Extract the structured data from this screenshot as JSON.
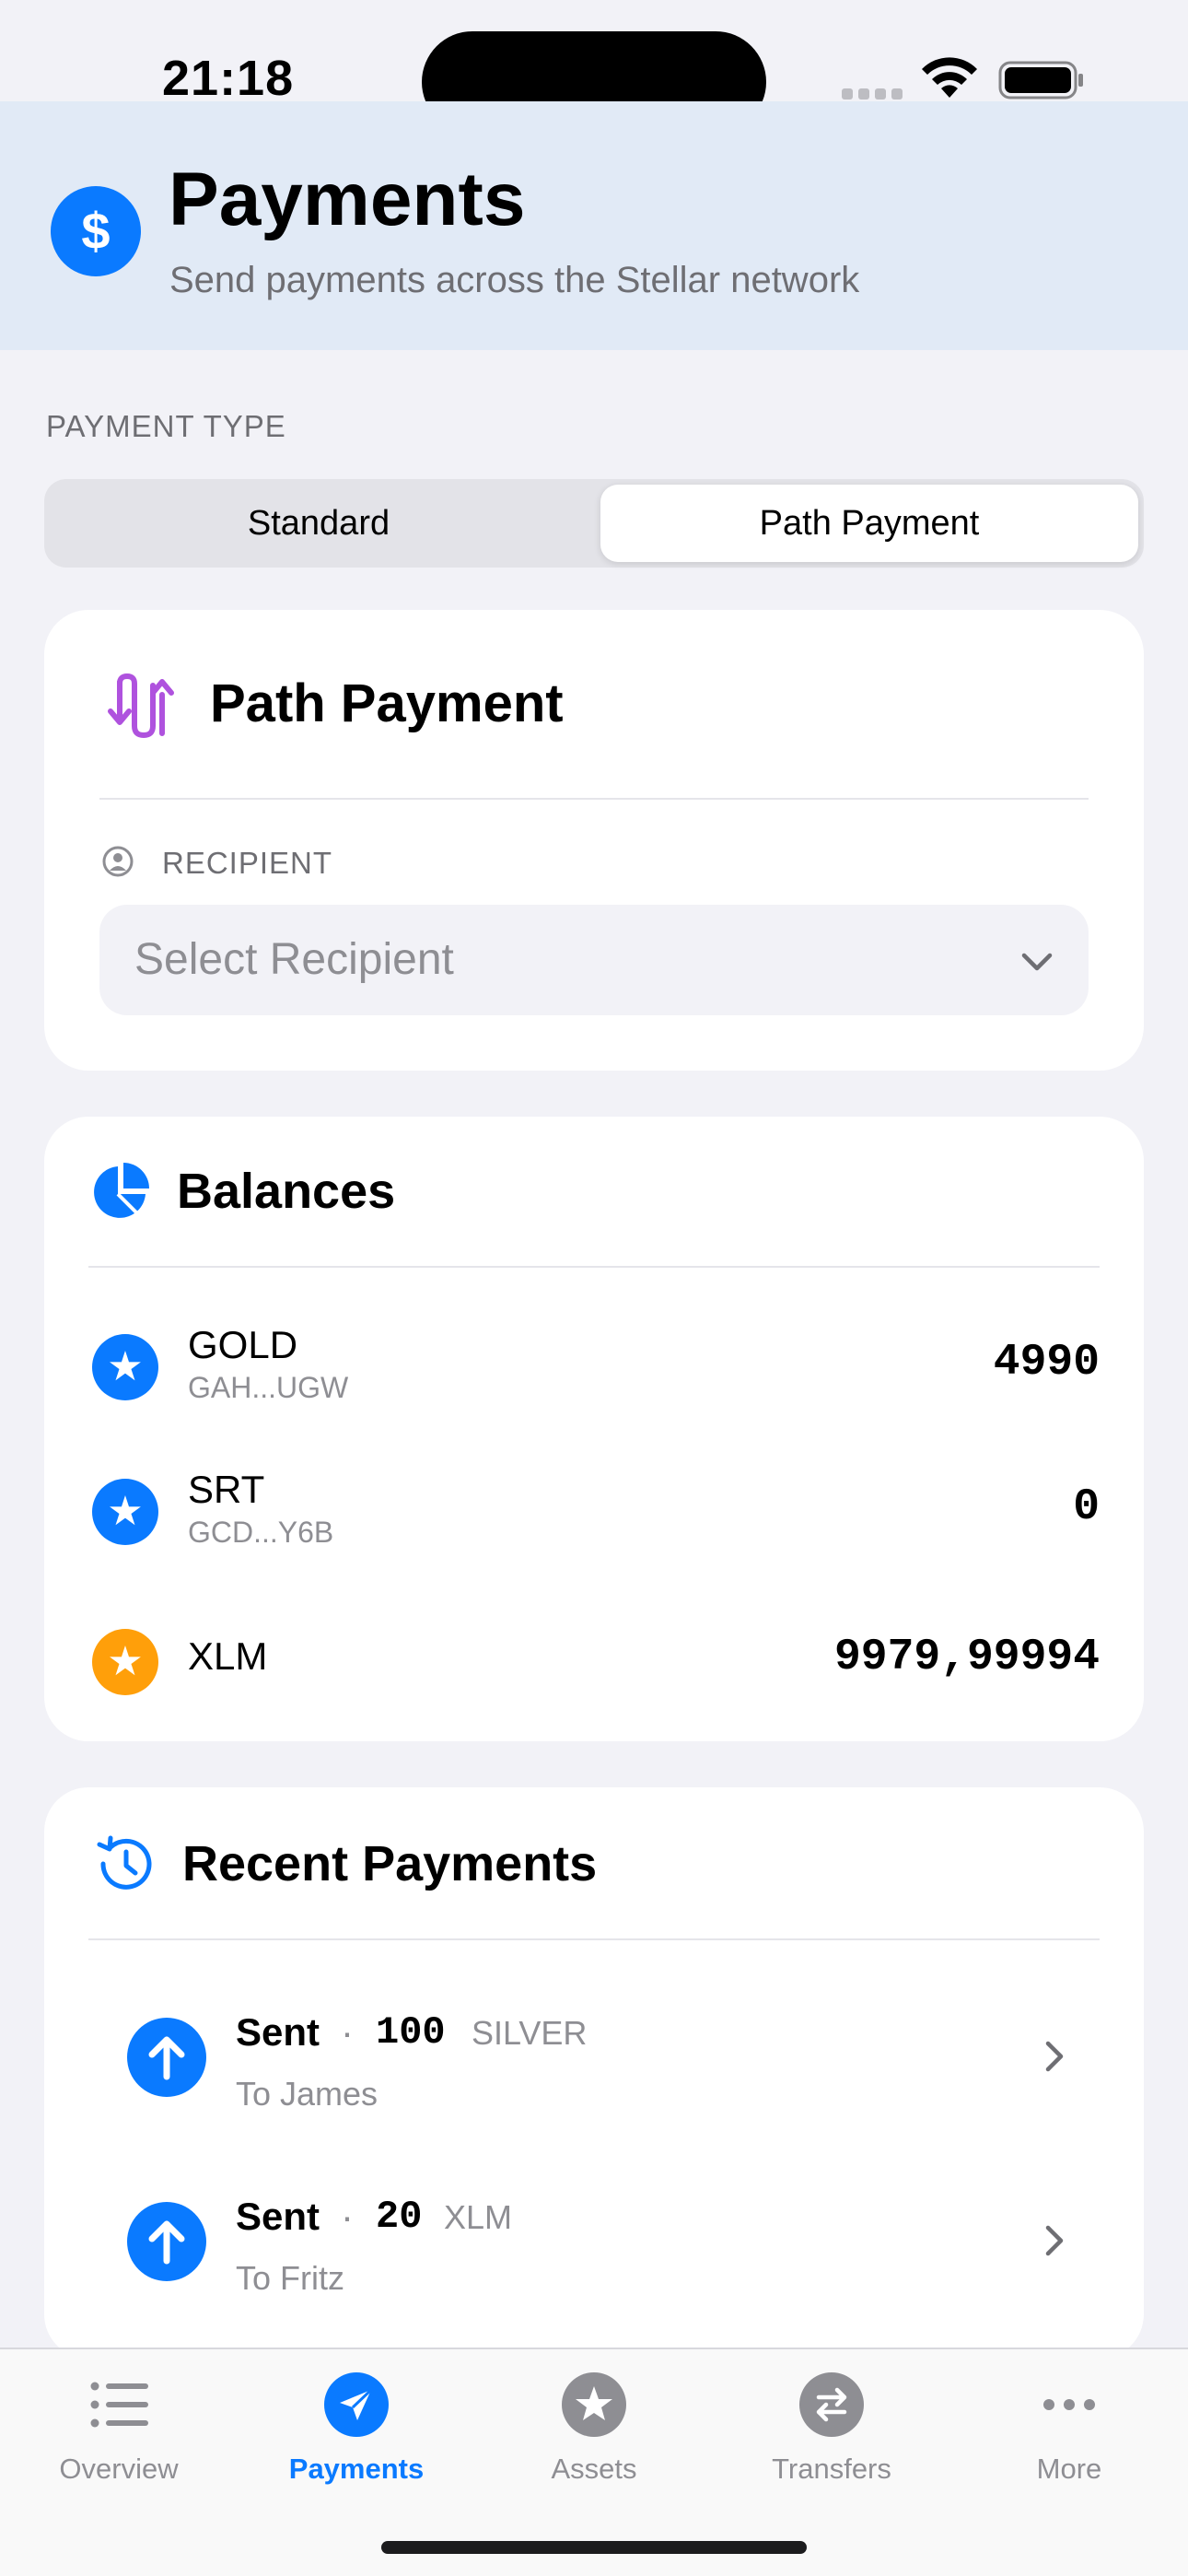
{
  "status_bar": {
    "time": "21:18"
  },
  "header": {
    "icon_glyph": "$",
    "title": "Payments",
    "subtitle": "Send payments across the Stellar network"
  },
  "payment_type": {
    "label": "PAYMENT TYPE",
    "options": [
      "Standard",
      "Path Payment"
    ],
    "selected": "Path Payment"
  },
  "path_payment": {
    "title": "Path Payment",
    "recipient_label": "RECIPIENT",
    "recipient_placeholder": "Select Recipient"
  },
  "balances": {
    "title": "Balances",
    "items": [
      {
        "asset": "GOLD",
        "issuer": "GAH...UGW",
        "amount": "4990",
        "icon": "star-icon",
        "color": "#0a7aff"
      },
      {
        "asset": "SRT",
        "issuer": "GCD...Y6B",
        "amount": "0",
        "icon": "star-icon",
        "color": "#0a7aff"
      },
      {
        "asset": "XLM",
        "issuer": "",
        "amount": "9979,99994",
        "icon": "star-icon",
        "color": "#ff9f0a"
      }
    ]
  },
  "recent_payments": {
    "title": "Recent Payments",
    "items": [
      {
        "status": "Sent",
        "amount": "100",
        "currency": "SILVER",
        "to": "To James"
      },
      {
        "status": "Sent",
        "amount": "20",
        "currency": "XLM",
        "to": "To Fritz"
      }
    ]
  },
  "tab_bar": {
    "tabs": [
      {
        "label": "Overview",
        "icon": "list-icon"
      },
      {
        "label": "Payments",
        "icon": "paperplane-icon"
      },
      {
        "label": "Assets",
        "icon": "star-circle-icon"
      },
      {
        "label": "Transfers",
        "icon": "arrows-circle-icon"
      },
      {
        "label": "More",
        "icon": "ellipsis-icon"
      }
    ],
    "active": "Payments"
  },
  "colors": {
    "accent": "#0a7aff",
    "xlm": "#ff9f0a",
    "path_payment": "#af52de"
  }
}
